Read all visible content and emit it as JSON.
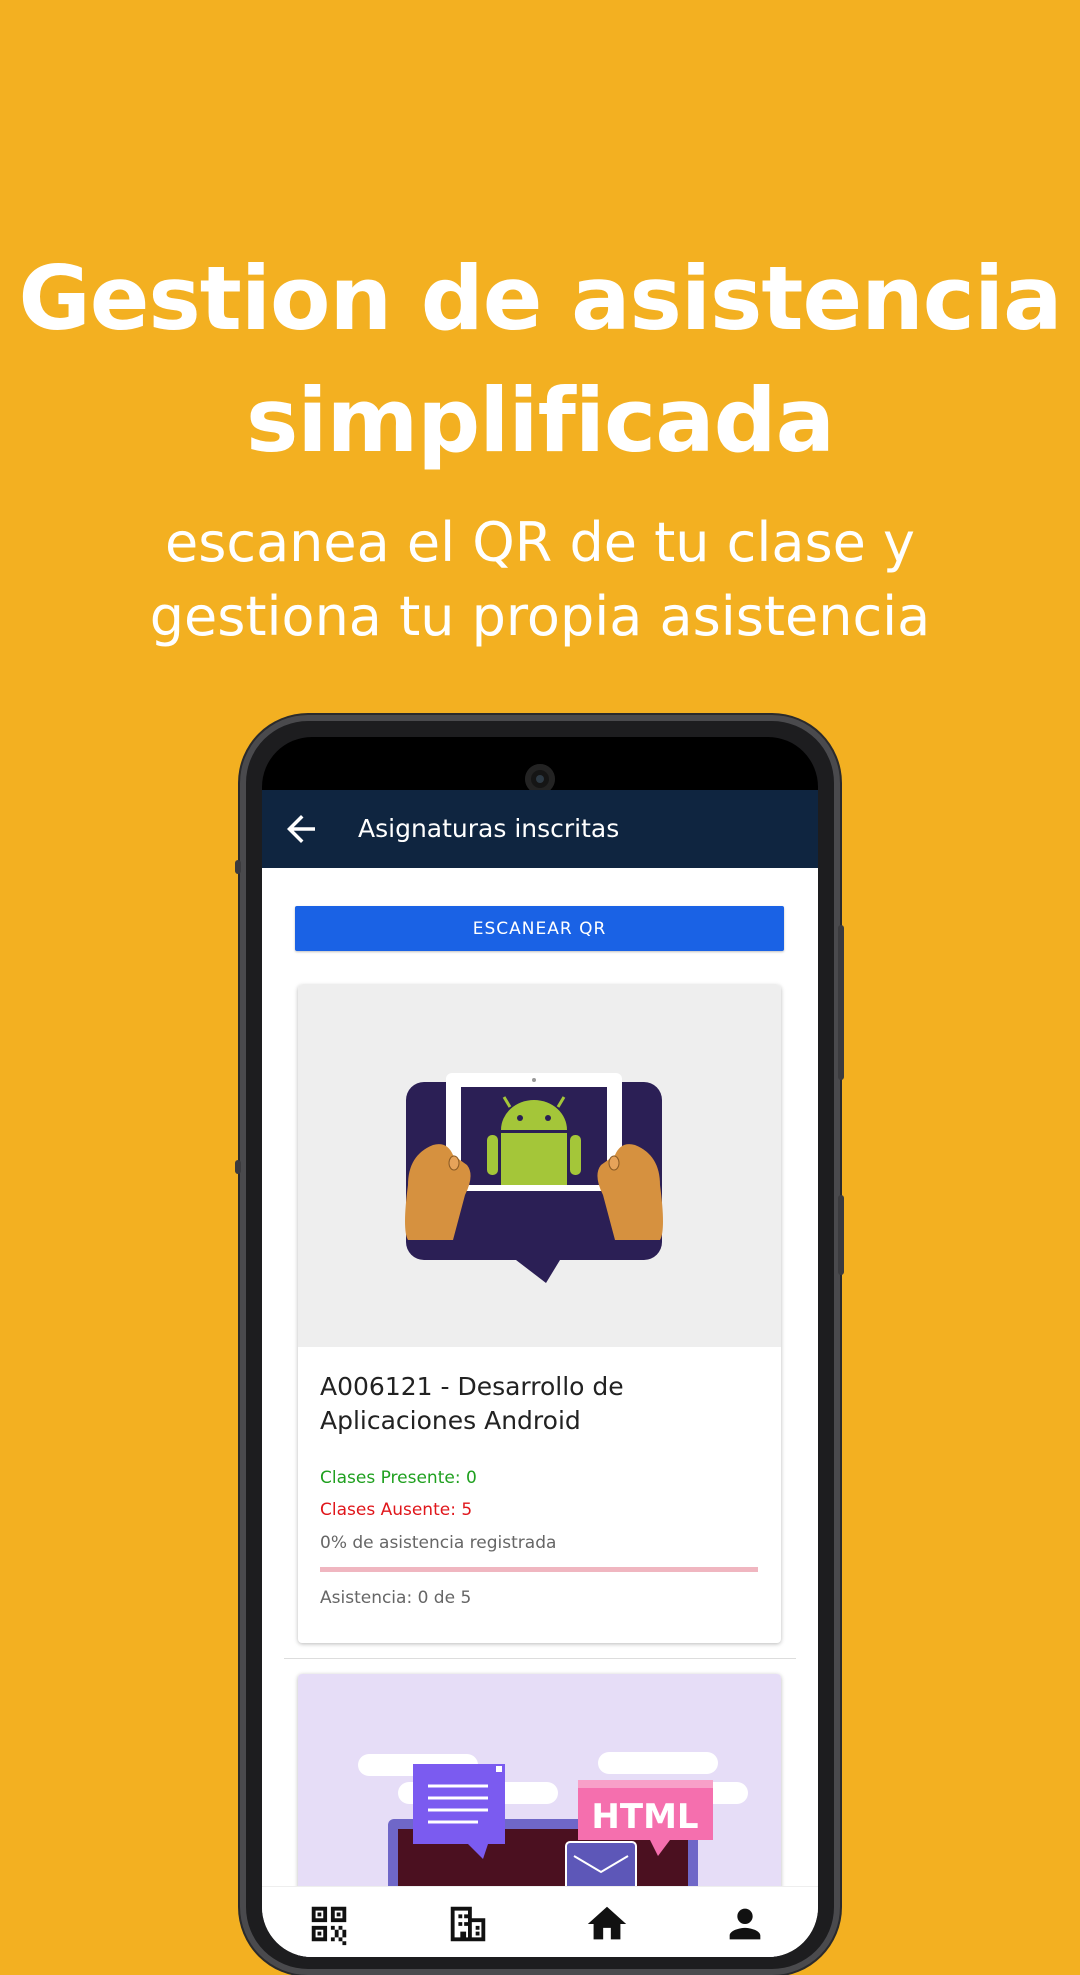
{
  "promo": {
    "headline_line1": "Gestion de asistencia",
    "headline_line2": "simplificada",
    "sub_line1": "escanea el QR de tu clase y",
    "sub_line2": "gestiona tu propia asistencia"
  },
  "appbar": {
    "title": "Asignaturas inscritas",
    "back_icon": "arrow-left-icon"
  },
  "scan_button": {
    "label": "ESCANEAR QR"
  },
  "courses": [
    {
      "title_line1": "A006121 - Desarrollo de",
      "title_line2": "Aplicaciones Android",
      "present": "Clases Presente: 0",
      "absent": "Clases Ausente: 5",
      "percent_text": "0% de asistencia registrada",
      "progress": 0,
      "attendance": "Asistencia: 0 de 5",
      "image_icon": "android-tablet-illustration"
    },
    {
      "image_label": "HTML",
      "image_icon": "web-development-illustration"
    }
  ],
  "bottom_nav": [
    {
      "icon": "qr-code-icon"
    },
    {
      "icon": "building-icon"
    },
    {
      "icon": "home-icon"
    },
    {
      "icon": "person-icon"
    }
  ],
  "colors": {
    "background": "#F3B021",
    "appbar": "#0F2540",
    "scan_button": "#1A62E5",
    "present": "#1FA01F",
    "absent": "#E0161B"
  }
}
